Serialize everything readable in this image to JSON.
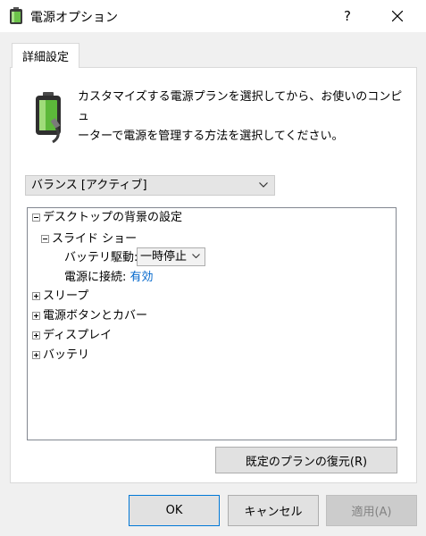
{
  "window": {
    "title": "電源オプション",
    "help_label": "?",
    "accent_color": "#0078d7"
  },
  "tab": {
    "label": "詳細設定"
  },
  "description": {
    "line1": "カスタマイズする電源プランを選択してから、お使いのコンピュ",
    "line2": "ーターで電源を管理する方法を選択してください。"
  },
  "plan_select": {
    "value": "バランス [アクティブ]",
    "icon": "chevron-down-icon"
  },
  "tree": {
    "desktop_bg": "デスクトップの背景の設定",
    "slideshow": "スライド ショー",
    "battery_label": "バッテリ駆動:",
    "battery_value": "一時停止",
    "plugged_label": "電源に接続:",
    "plugged_value": "有効",
    "sleep": "スリープ",
    "power_buttons": "電源ボタンとカバー",
    "display": "ディスプレイ",
    "battery": "バッテリ"
  },
  "buttons": {
    "restore": "既定のプランの復元(R)",
    "ok": "OK",
    "cancel": "キャンセル",
    "apply": "適用(A)"
  }
}
